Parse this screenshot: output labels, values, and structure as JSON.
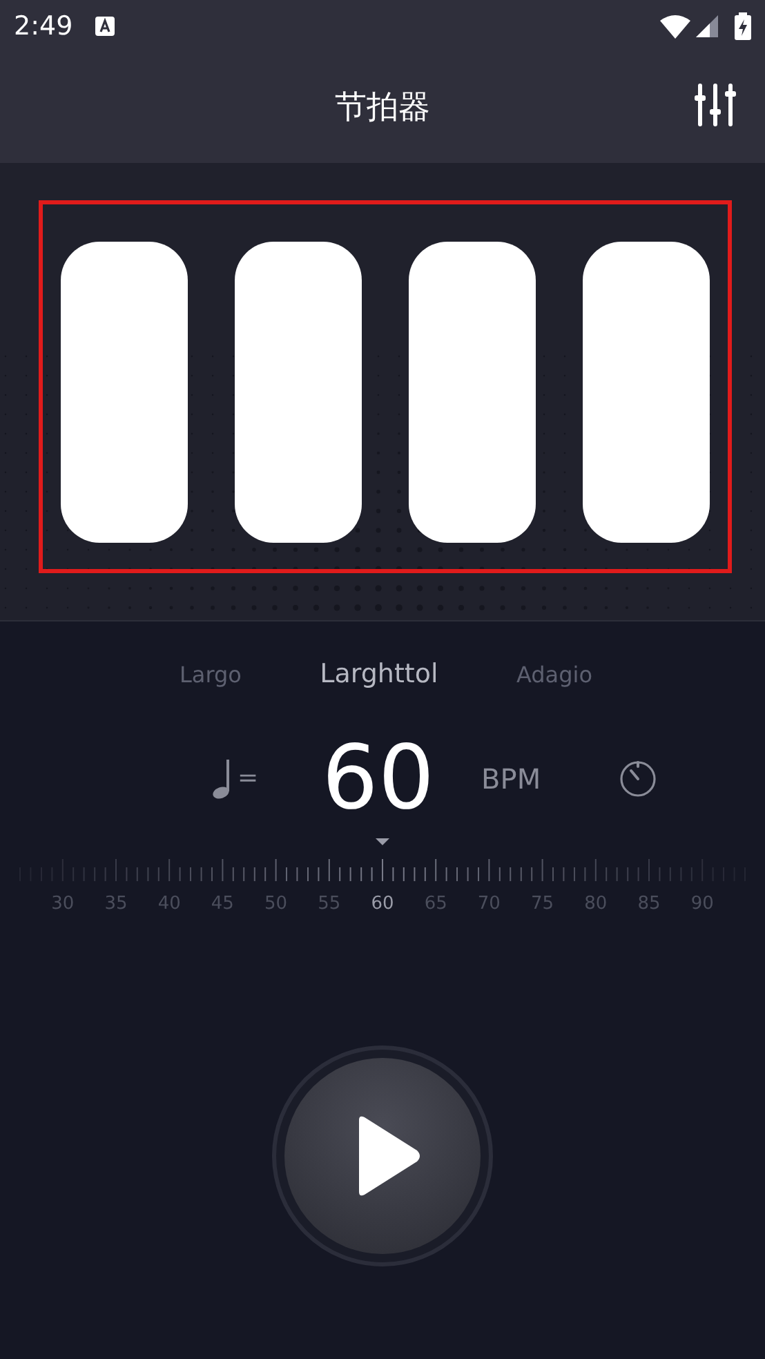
{
  "status_bar": {
    "time": "2:49"
  },
  "header": {
    "title": "节拍器"
  },
  "beats": [
    {
      "on": true
    },
    {
      "on": true
    },
    {
      "on": true
    },
    {
      "on": true
    }
  ],
  "highlight": {
    "visible": true,
    "color": "#e01b1b"
  },
  "tempo_names": [
    {
      "label": "Largo",
      "selected": false
    },
    {
      "label": "Larghttol",
      "selected": true
    },
    {
      "label": "Adagio",
      "selected": false
    }
  ],
  "tempo": {
    "note_equals": "=",
    "bpm": "60",
    "unit": "BPM"
  },
  "ruler": {
    "labels": [
      {
        "label": "30",
        "selected": false
      },
      {
        "label": "35",
        "selected": false
      },
      {
        "label": "40",
        "selected": false
      },
      {
        "label": "45",
        "selected": false
      },
      {
        "label": "50",
        "selected": false
      },
      {
        "label": "55",
        "selected": false
      },
      {
        "label": "60",
        "selected": true
      },
      {
        "label": "65",
        "selected": false
      },
      {
        "label": "70",
        "selected": false
      },
      {
        "label": "75",
        "selected": false
      },
      {
        "label": "80",
        "selected": false
      },
      {
        "label": "85",
        "selected": false
      },
      {
        "label": "90",
        "selected": false
      }
    ]
  }
}
